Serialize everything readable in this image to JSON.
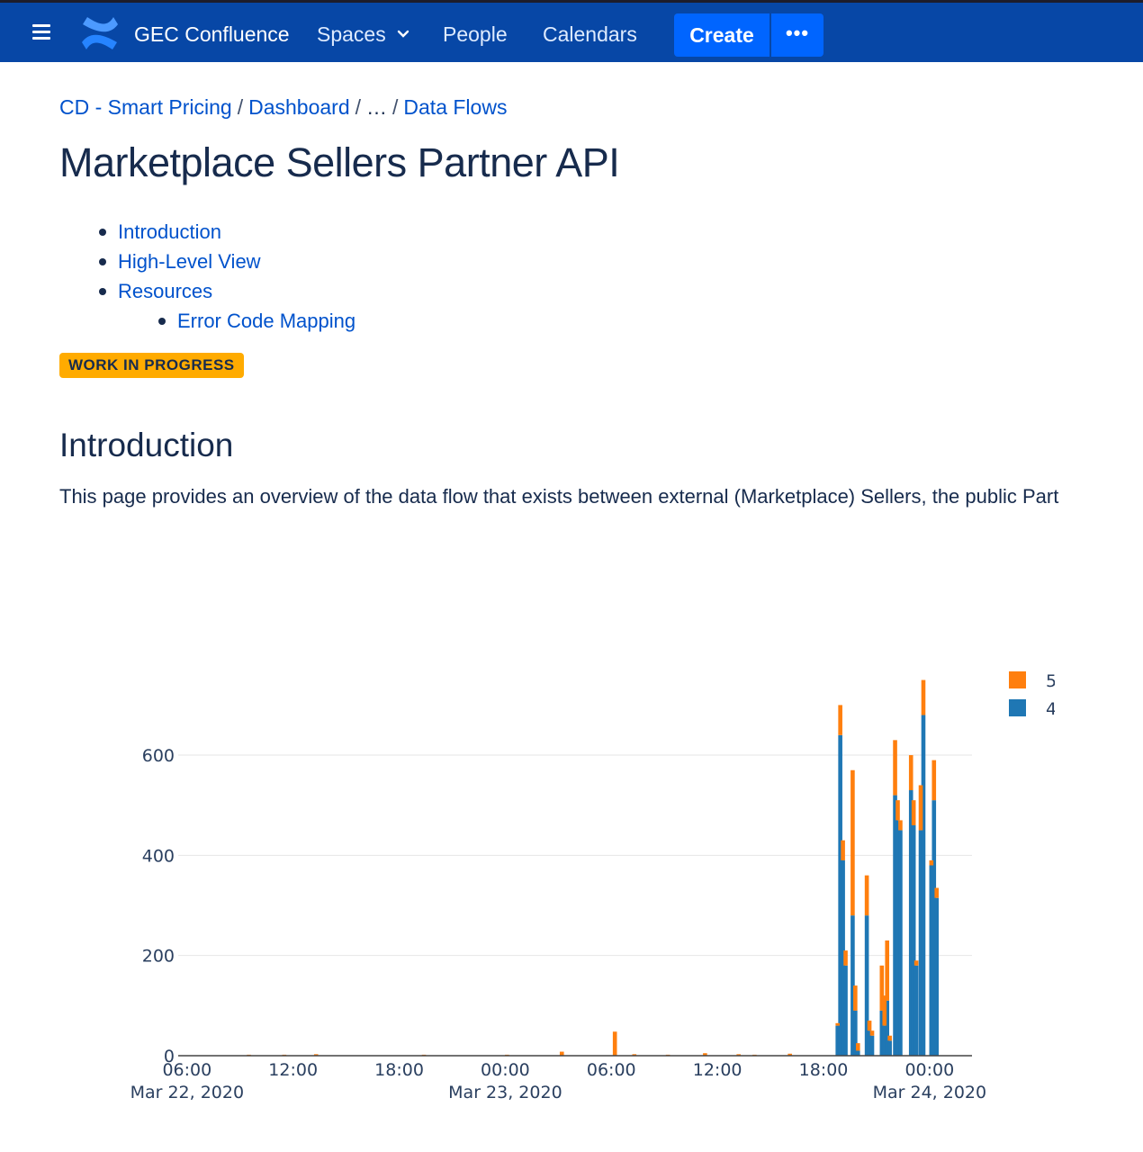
{
  "nav": {
    "app_title": "GEC Confluence",
    "spaces": "Spaces",
    "people": "People",
    "calendars": "Calendars",
    "create": "Create",
    "more": "•••",
    "brand_color": "#0747a6",
    "create_color": "#0065ff"
  },
  "breadcrumb": {
    "items": [
      "CD - Smart Pricing",
      "Dashboard",
      "…",
      "Data Flows"
    ]
  },
  "page": {
    "title": "Marketplace Sellers Partner API",
    "status": "WORK IN PROGRESS",
    "status_color": "#ffab00"
  },
  "toc": {
    "items": [
      {
        "label": "Introduction",
        "level": 1
      },
      {
        "label": "High-Level View",
        "level": 1
      },
      {
        "label": "Resources",
        "level": 1
      },
      {
        "label": "Error Code Mapping",
        "level": 2
      }
    ]
  },
  "intro": {
    "heading": "Introduction",
    "text": "This page provides an overview of the data flow that exists between external (Marketplace) Sellers, the public Part"
  },
  "chart_data": {
    "type": "bar",
    "stacked": true,
    "x_unit": "hours since 2020-03-22 00:00",
    "yticks": [
      0,
      200,
      400,
      600
    ],
    "ylim": [
      0,
      760
    ],
    "xlim": [
      5.5,
      50.4
    ],
    "xticks": [
      {
        "x": 6,
        "label": "06:00",
        "sub": "Mar 22, 2020"
      },
      {
        "x": 12,
        "label": "12:00",
        "sub": ""
      },
      {
        "x": 18,
        "label": "18:00",
        "sub": ""
      },
      {
        "x": 24,
        "label": "00:00",
        "sub": "Mar 23, 2020"
      },
      {
        "x": 30,
        "label": "06:00",
        "sub": ""
      },
      {
        "x": 36,
        "label": "12:00",
        "sub": ""
      },
      {
        "x": 42,
        "label": "18:00",
        "sub": ""
      },
      {
        "x": 48,
        "label": "00:00",
        "sub": "Mar 24, 2020"
      }
    ],
    "grid": true,
    "legend_position": "top-right",
    "series": [
      {
        "name": "4",
        "color": "#1f77b4",
        "x": [
          42.8,
          42.95,
          43.1,
          43.25,
          43.65,
          43.8,
          43.95,
          44.45,
          44.6,
          44.75,
          45.3,
          45.45,
          45.6,
          45.75,
          46.05,
          46.2,
          46.35,
          46.95,
          47.1,
          47.25,
          47.5,
          47.65,
          48.1,
          48.25,
          48.4
        ],
        "values": [
          60,
          640,
          390,
          180,
          280,
          90,
          10,
          280,
          50,
          40,
          90,
          60,
          110,
          30,
          520,
          470,
          450,
          530,
          460,
          180,
          450,
          680,
          380,
          510,
          315
        ]
      },
      {
        "name": "5",
        "color": "#ff7f0e",
        "x": [
          9.5,
          11.5,
          13.3,
          19.4,
          24.1,
          27.2,
          30.2,
          31.3,
          33.2,
          35.3,
          37.2,
          38.1,
          40.1,
          42.8,
          42.95,
          43.1,
          43.25,
          43.65,
          43.8,
          43.95,
          44.45,
          44.6,
          44.75,
          45.3,
          45.45,
          45.6,
          45.75,
          46.05,
          46.2,
          46.35,
          46.95,
          47.1,
          47.25,
          47.5,
          47.65,
          48.1,
          48.25,
          48.4
        ],
        "values": [
          2,
          2,
          3,
          2,
          2,
          8,
          48,
          3,
          2,
          5,
          3,
          2,
          4,
          5,
          60,
          40,
          30,
          290,
          50,
          15,
          80,
          20,
          10,
          90,
          60,
          120,
          10,
          110,
          40,
          20,
          70,
          50,
          10,
          90,
          70,
          10,
          80,
          20
        ]
      }
    ]
  }
}
